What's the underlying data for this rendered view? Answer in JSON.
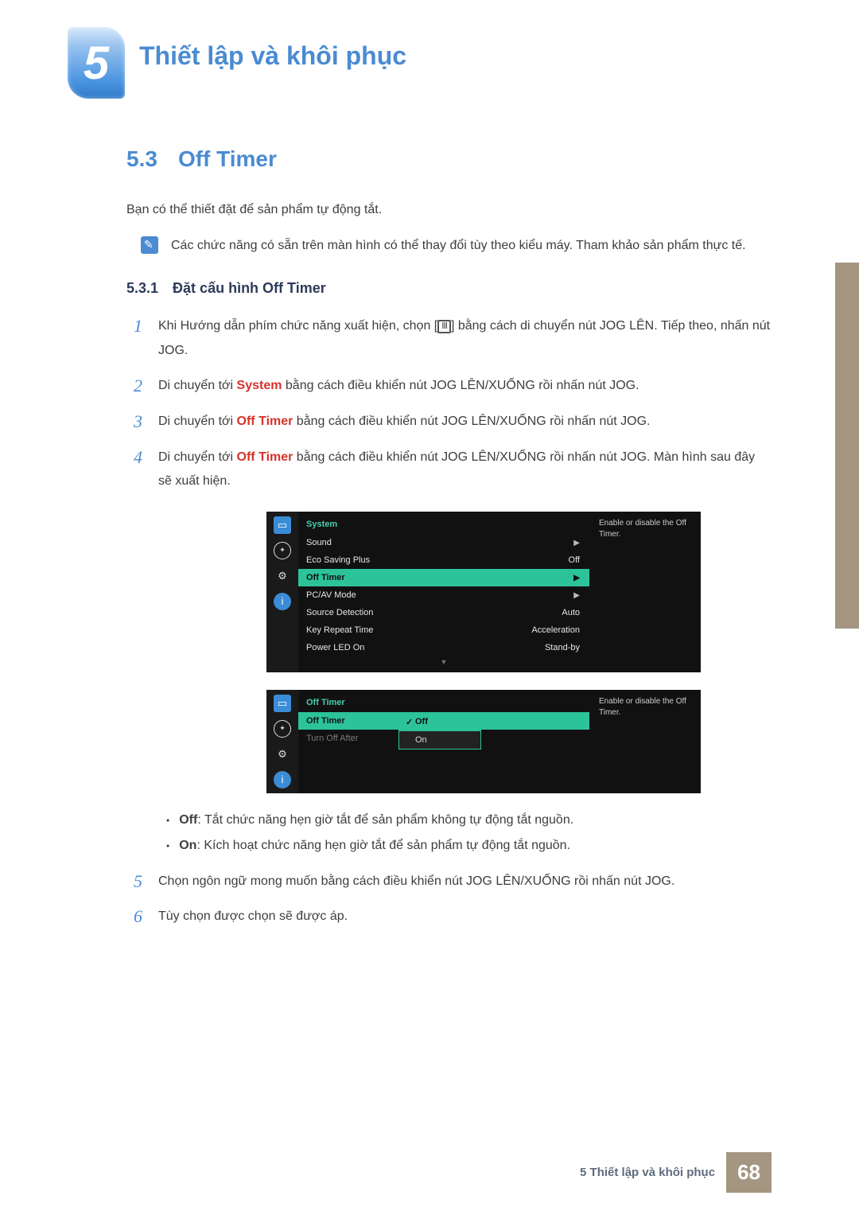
{
  "chapter": {
    "number": "5",
    "title": "Thiết lập và khôi phục"
  },
  "section": {
    "number": "5.3",
    "title": "Off Timer"
  },
  "intro": "Bạn có thể thiết đặt để sản phẩm tự động tắt.",
  "note": "Các chức năng có sẵn trên màn hình có thể thay đổi tùy theo kiểu máy. Tham khảo sản phẩm thực tế.",
  "subsection": {
    "number": "5.3.1",
    "title": "Đặt cấu hình Off Timer"
  },
  "steps": {
    "s1a": "Khi Hướng dẫn phím chức năng xuất hiện, chọn [",
    "s1b": "] bằng cách di chuyển nút JOG LÊN. Tiếp theo, nhấn nút JOG.",
    "s2a": "Di chuyển tới ",
    "s2_system": "System",
    "s2b": " bằng cách điều khiển nút JOG LÊN/XUỐNG rồi nhấn nút JOG.",
    "s3a": "Di chuyển tới ",
    "s3_off": "Off Timer",
    "s3b": " bằng cách điều khiển nút JOG LÊN/XUỐNG rồi nhấn nút JOG.",
    "s4a": "Di chuyển tới ",
    "s4_off": "Off Timer",
    "s4b": " bằng cách điều khiển nút JOG LÊN/XUỐNG rồi nhấn nút JOG. Màn hình sau đây sẽ xuất hiện.",
    "s5": "Chọn ngôn ngữ mong muốn bằng cách điều khiển nút JOG LÊN/XUỐNG rồi nhấn nút JOG.",
    "s6": "Tùy chọn được chọn sẽ được áp."
  },
  "osd1": {
    "title": "System",
    "rows": [
      {
        "label": "Sound",
        "value": "",
        "arrow": true
      },
      {
        "label": "Eco Saving Plus",
        "value": "Off"
      },
      {
        "label": "Off Timer",
        "value": "",
        "arrow": true,
        "selected": true
      },
      {
        "label": "PC/AV Mode",
        "value": "",
        "arrow": true
      },
      {
        "label": "Source Detection",
        "value": "Auto"
      },
      {
        "label": "Key Repeat Time",
        "value": "Acceleration"
      },
      {
        "label": "Power LED On",
        "value": "Stand-by"
      }
    ],
    "desc": "Enable or disable the Off Timer."
  },
  "osd2": {
    "title": "Off Timer",
    "rows": [
      {
        "label": "Off Timer",
        "selected": true
      },
      {
        "label": "Turn Off After",
        "dim": true
      }
    ],
    "popup": [
      {
        "label": "Off",
        "active": true
      },
      {
        "label": "On"
      }
    ],
    "desc": "Enable or disable the Off Timer."
  },
  "bullets": {
    "off_label": "Off",
    "off_text": ": Tắt chức năng hẹn giờ tắt để sản phẩm không tự động tắt nguồn.",
    "on_label": "On",
    "on_text": ": Kích hoạt chức năng hẹn giờ tắt để sản phẩm tự động tắt nguồn."
  },
  "footer": {
    "text": "5 Thiết lập và khôi phục",
    "page": "68"
  }
}
